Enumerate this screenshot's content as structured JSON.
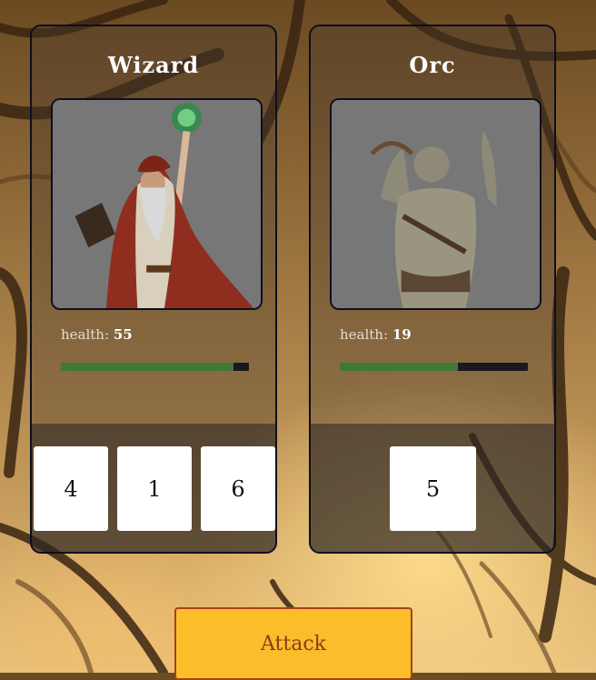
{
  "player": {
    "name": "Wizard",
    "health_label": "health:",
    "health": "55",
    "health_fraction": 0.92,
    "dice": [
      "4",
      "1",
      "6"
    ]
  },
  "enemy": {
    "name": "Orc",
    "health_label": "health:",
    "health": "19",
    "health_fraction": 0.63,
    "dice": [
      "5"
    ]
  },
  "attack_label": "Attack",
  "colors": {
    "health_fill": "#3f7a34",
    "attack_button": "#fbbd2a",
    "card_border": "#0d0f1e"
  }
}
